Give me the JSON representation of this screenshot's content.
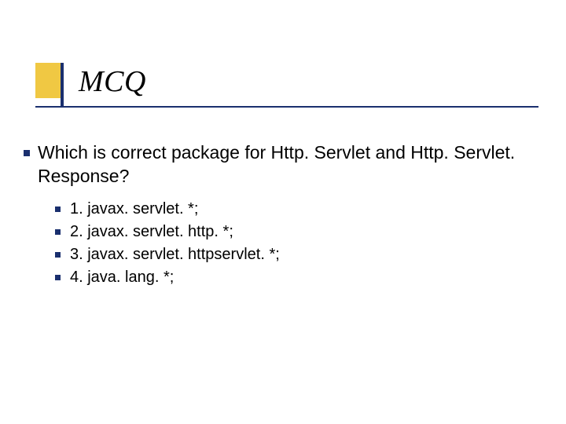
{
  "title": "MCQ",
  "question": "Which is correct package for Http. Servlet and Http. Servlet. Response?",
  "options": [
    "1. javax. servlet. *;",
    "2. javax. servlet. http. *;",
    "3. javax. servlet. httpservlet. *;",
    "4. java. lang. *;"
  ]
}
